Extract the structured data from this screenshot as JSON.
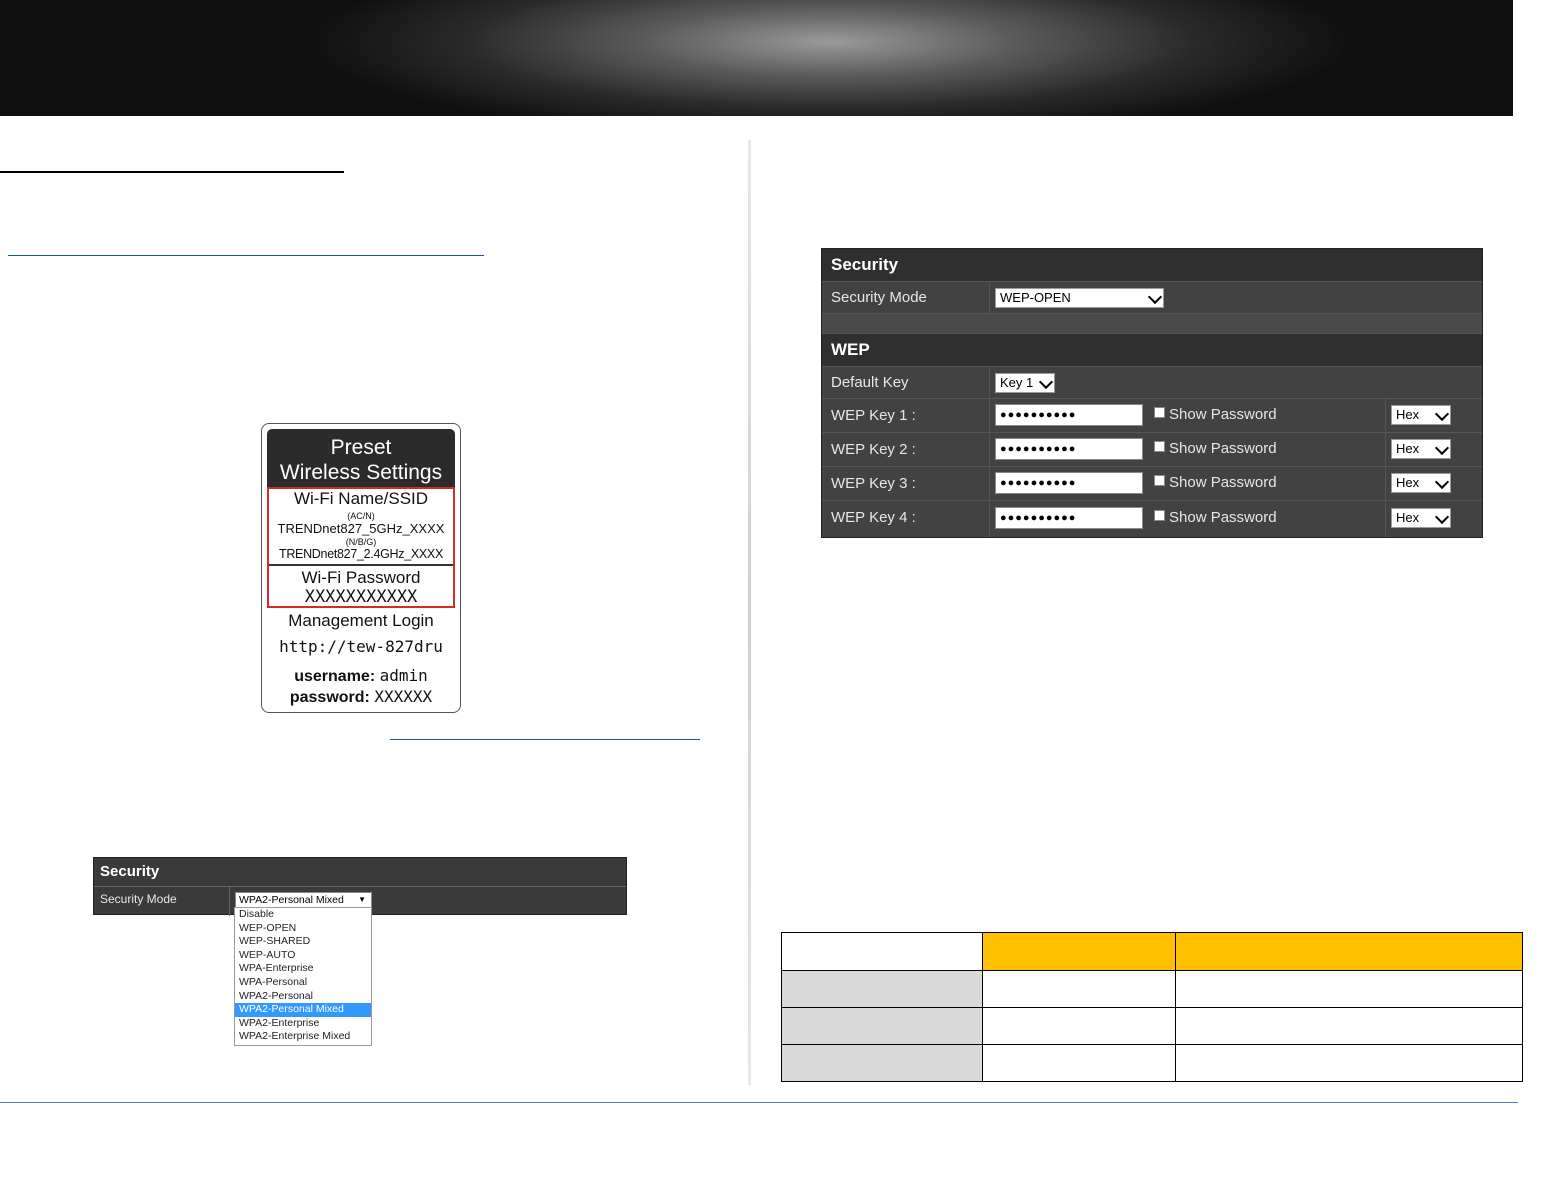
{
  "colors": {
    "accent_gold": "#ffc000",
    "panel_dark": "#3a3a3a",
    "highlight_blue": "#3399ff",
    "footer_line": "#4a7dc8",
    "sticker_red": "#d42a2a"
  },
  "sticker": {
    "title_line1": "Preset",
    "title_line2": "Wireless Settings",
    "ssid_title": "Wi-Fi Name/SSID",
    "band1": "(AC/N)",
    "ssid1": "TRENDnet827_5GHz_XXXX",
    "band2": "(N/B/G)",
    "ssid2": "TRENDnet827_2.4GHz_XXXX",
    "password_title": "Wi-Fi Password",
    "password_value": "XXXXXXXXXXX",
    "mgmt_title": "Management Login",
    "mgmt_url": "http://tew-827dru",
    "username_label": "username:",
    "username_value": "admin",
    "password_label": "password:",
    "password_login_value": "XXXXXX"
  },
  "security_small": {
    "title": "Security",
    "mode_label": "Security Mode",
    "selected": "WPA2-Personal Mixed",
    "arrow": "▼",
    "options": [
      "Disable",
      "WEP-OPEN",
      "WEP-SHARED",
      "WEP-AUTO",
      "WPA-Enterprise",
      "WPA-Personal",
      "WPA2-Personal",
      "WPA2-Personal Mixed",
      "WPA2-Enterprise",
      "WPA2-Enterprise Mixed"
    ]
  },
  "security_big": {
    "title": "Security",
    "mode_label": "Security Mode",
    "mode_value": "WEP-OPEN",
    "wep_title": "WEP",
    "default_key_label": "Default Key",
    "default_key_value": "Key 1",
    "keys": [
      {
        "label": "WEP Key 1 :",
        "value": "●●●●●●●●●●",
        "show_label": "Show Password",
        "format": "Hex"
      },
      {
        "label": "WEP Key 2 :",
        "value": "●●●●●●●●●●",
        "show_label": "Show Password",
        "format": "Hex"
      },
      {
        "label": "WEP Key 3 :",
        "value": "●●●●●●●●●●",
        "show_label": "Show Password",
        "format": "Hex"
      },
      {
        "label": "WEP Key 4 :",
        "value": "●●●●●●●●●●",
        "show_label": "Show Password",
        "format": "Hex"
      }
    ]
  }
}
